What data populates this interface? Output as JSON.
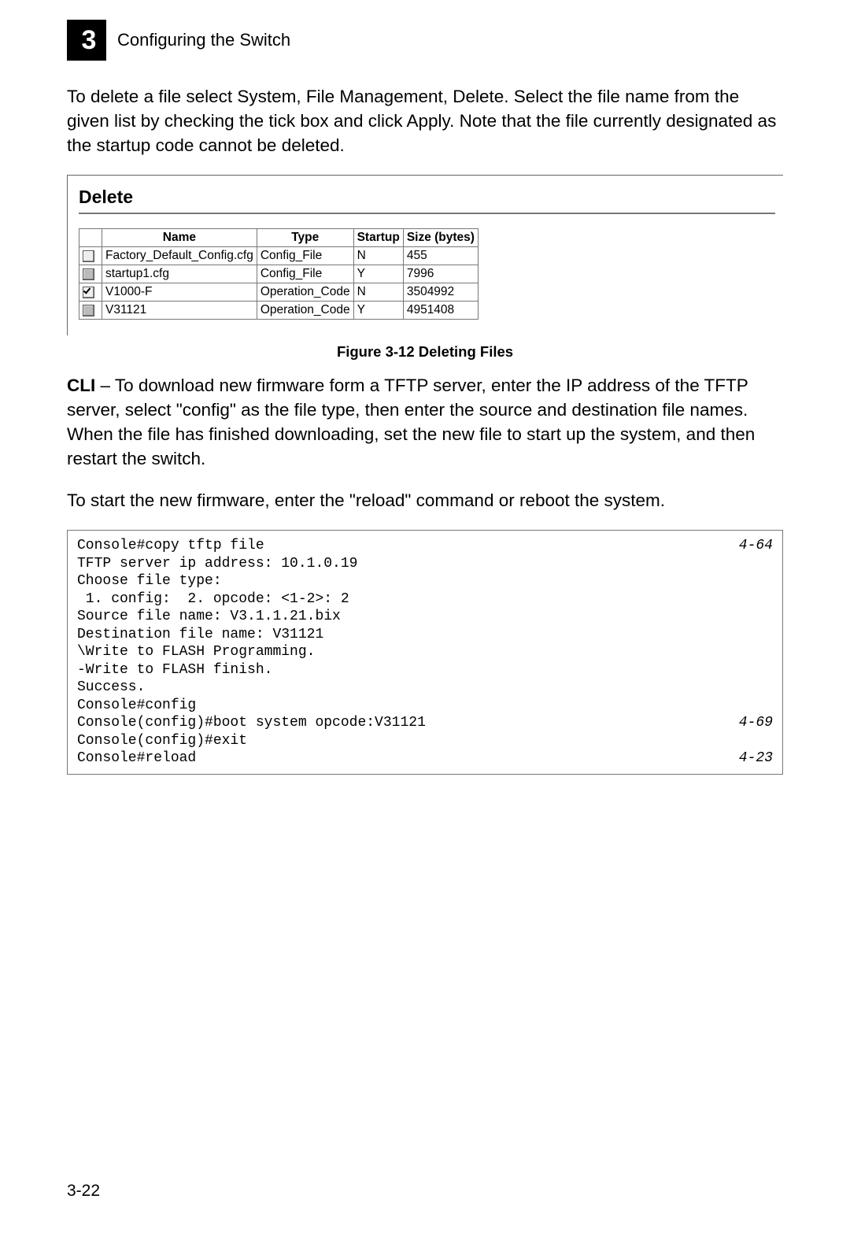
{
  "header": {
    "chapter_number": "3",
    "chapter_title": "Configuring the Switch"
  },
  "paragraphs": {
    "intro": "To delete a file select System, File Management, Delete. Select the file name from the given list by checking the tick box and click Apply. Note that the file currently designated as the startup code cannot be deleted.",
    "cli1_prefix": "CLI",
    "cli1_body": " – To download new firmware form a TFTP server, enter the IP address of the TFTP server, select \"config\" as the file type, then enter the source and destination file names. When the file has finished downloading, set the new file to start up the system, and then restart the switch.",
    "cli2": "To start the new firmware, enter the \"reload\" command or reboot the system."
  },
  "delete_panel": {
    "title": "Delete",
    "columns": [
      "",
      "Name",
      "Type",
      "Startup",
      "Size (bytes)"
    ],
    "rows": [
      {
        "checked": false,
        "gray": false,
        "name": "Factory_Default_Config.cfg",
        "type": "Config_File",
        "startup": "N",
        "size": "455"
      },
      {
        "checked": false,
        "gray": true,
        "name": "startup1.cfg",
        "type": "Config_File",
        "startup": "Y",
        "size": "7996"
      },
      {
        "checked": true,
        "gray": false,
        "name": "V1000-F",
        "type": "Operation_Code",
        "startup": "N",
        "size": "3504992"
      },
      {
        "checked": false,
        "gray": true,
        "name": "V31121",
        "type": "Operation_Code",
        "startup": "Y",
        "size": "4951408"
      }
    ]
  },
  "figure_caption": "Figure 3-12   Deleting Files",
  "cli_output": {
    "lines": [
      {
        "text": "Console#copy tftp file",
        "ref": "4-64"
      },
      {
        "text": "TFTP server ip address: 10.1.0.19",
        "ref": ""
      },
      {
        "text": "Choose file type:",
        "ref": ""
      },
      {
        "text": " 1. config:  2. opcode: <1-2>: 2",
        "ref": ""
      },
      {
        "text": "Source file name: V3.1.1.21.bix",
        "ref": ""
      },
      {
        "text": "Destination file name: V31121",
        "ref": ""
      },
      {
        "text": "\\Write to FLASH Programming.",
        "ref": ""
      },
      {
        "text": "-Write to FLASH finish.",
        "ref": ""
      },
      {
        "text": "Success.",
        "ref": ""
      },
      {
        "text": "Console#config",
        "ref": ""
      },
      {
        "text": "Console(config)#boot system opcode:V31121",
        "ref": "4-69"
      },
      {
        "text": "Console(config)#exit",
        "ref": ""
      },
      {
        "text": "Console#reload",
        "ref": "4-23"
      }
    ]
  },
  "page_number": "3-22"
}
